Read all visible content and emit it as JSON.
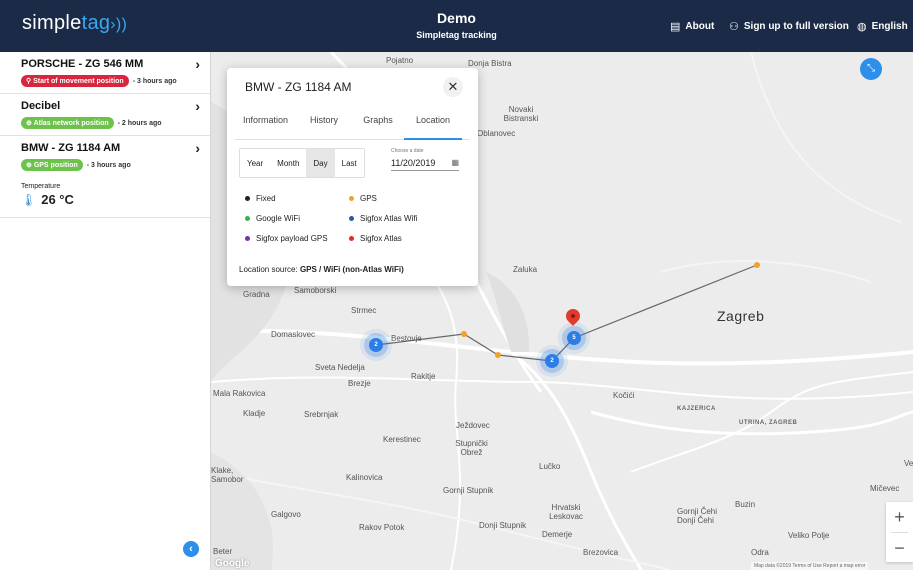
{
  "header": {
    "logo_simple": "simple",
    "logo_tag": "tag",
    "title": "Demo",
    "subtitle": "Simpletag tracking",
    "nav": [
      {
        "label": "About",
        "icon": "document-icon",
        "glyph": "▤"
      },
      {
        "label": "Sign up to full version",
        "icon": "add-user-icon",
        "glyph": "⚇"
      },
      {
        "label": "English",
        "icon": "globe-icon",
        "glyph": "◍"
      }
    ]
  },
  "sidebar": {
    "vehicles": [
      {
        "name": "PORSCHE - ZG 546 MM",
        "badge": "Start of movement position",
        "badge_color": "#d7263d",
        "ago": "3 hours ago"
      },
      {
        "name": "Decibel",
        "badge": "Atlas network position",
        "badge_color": "#6cc24a",
        "ago": "2 hours ago"
      },
      {
        "name": "BMW - ZG 1184 AM",
        "badge": "GPS position",
        "badge_color": "#6cc24a",
        "ago": "3 hours ago",
        "temp_label": "Temperature",
        "temp_value": "26 °C"
      }
    ]
  },
  "popup": {
    "title": "BMW - ZG 1184 AM",
    "tabs": [
      "Information",
      "History",
      "Graphs",
      "Location"
    ],
    "active_tab": "Location",
    "periods": [
      "Year",
      "Month",
      "Day",
      "Last"
    ],
    "selected_period": "Day",
    "date_label": "Choose a date",
    "date_value": "11/20/2019",
    "legend": [
      {
        "label": "Fixed",
        "color": "#222222"
      },
      {
        "label": "GPS",
        "color": "#f2a12a"
      },
      {
        "label": "Google WiFi",
        "color": "#3cb043"
      },
      {
        "label": "Sigfox Atlas Wifi",
        "color": "#1f5fa8"
      },
      {
        "label": "Sigfox payload GPS",
        "color": "#7b2fa8"
      },
      {
        "label": "Sigfox Atlas",
        "color": "#e02b2b"
      }
    ],
    "source_label": "Location source:",
    "source_value": "GPS / WiFi (non-Atlas WiFi)"
  },
  "map": {
    "places": [
      "Pojatno",
      "Donja Bistra",
      "Novaki Bistranski",
      "Oblanovec",
      "Zaluka",
      "Zagreb",
      "Gradna",
      "Samoborski",
      "Strmec",
      "Domaslovec",
      "Bestovje",
      "Sveta Nedelja",
      "Brezje",
      "Rakitje",
      "Kočići",
      "KAJZERICA",
      "UTRINA, ZAGREB",
      "Mala Rakovica",
      "Kladje",
      "Srebrnjak",
      "Ježdovec",
      "Kerestinec",
      "Stupnički Obrež",
      "Lučko",
      "Klake, Samobor",
      "Kalinovica",
      "Gornji Stupnik",
      "Galgovo",
      "Rakov Potok",
      "Donji Stupnik",
      "Hrvatski Leskovac",
      "Demerje",
      "Gornji Čehi Donji Čehi",
      "Buzin",
      "Veliko Polje",
      "Mičevec",
      "Odra",
      "Brezovica",
      "Beter",
      "Ve"
    ],
    "clusters": [
      "2",
      "2",
      "5"
    ],
    "zoom_in": "+",
    "zoom_out": "−",
    "attribution": "Map data ©2019   Terms of Use   Report a map error",
    "google": "Google"
  }
}
